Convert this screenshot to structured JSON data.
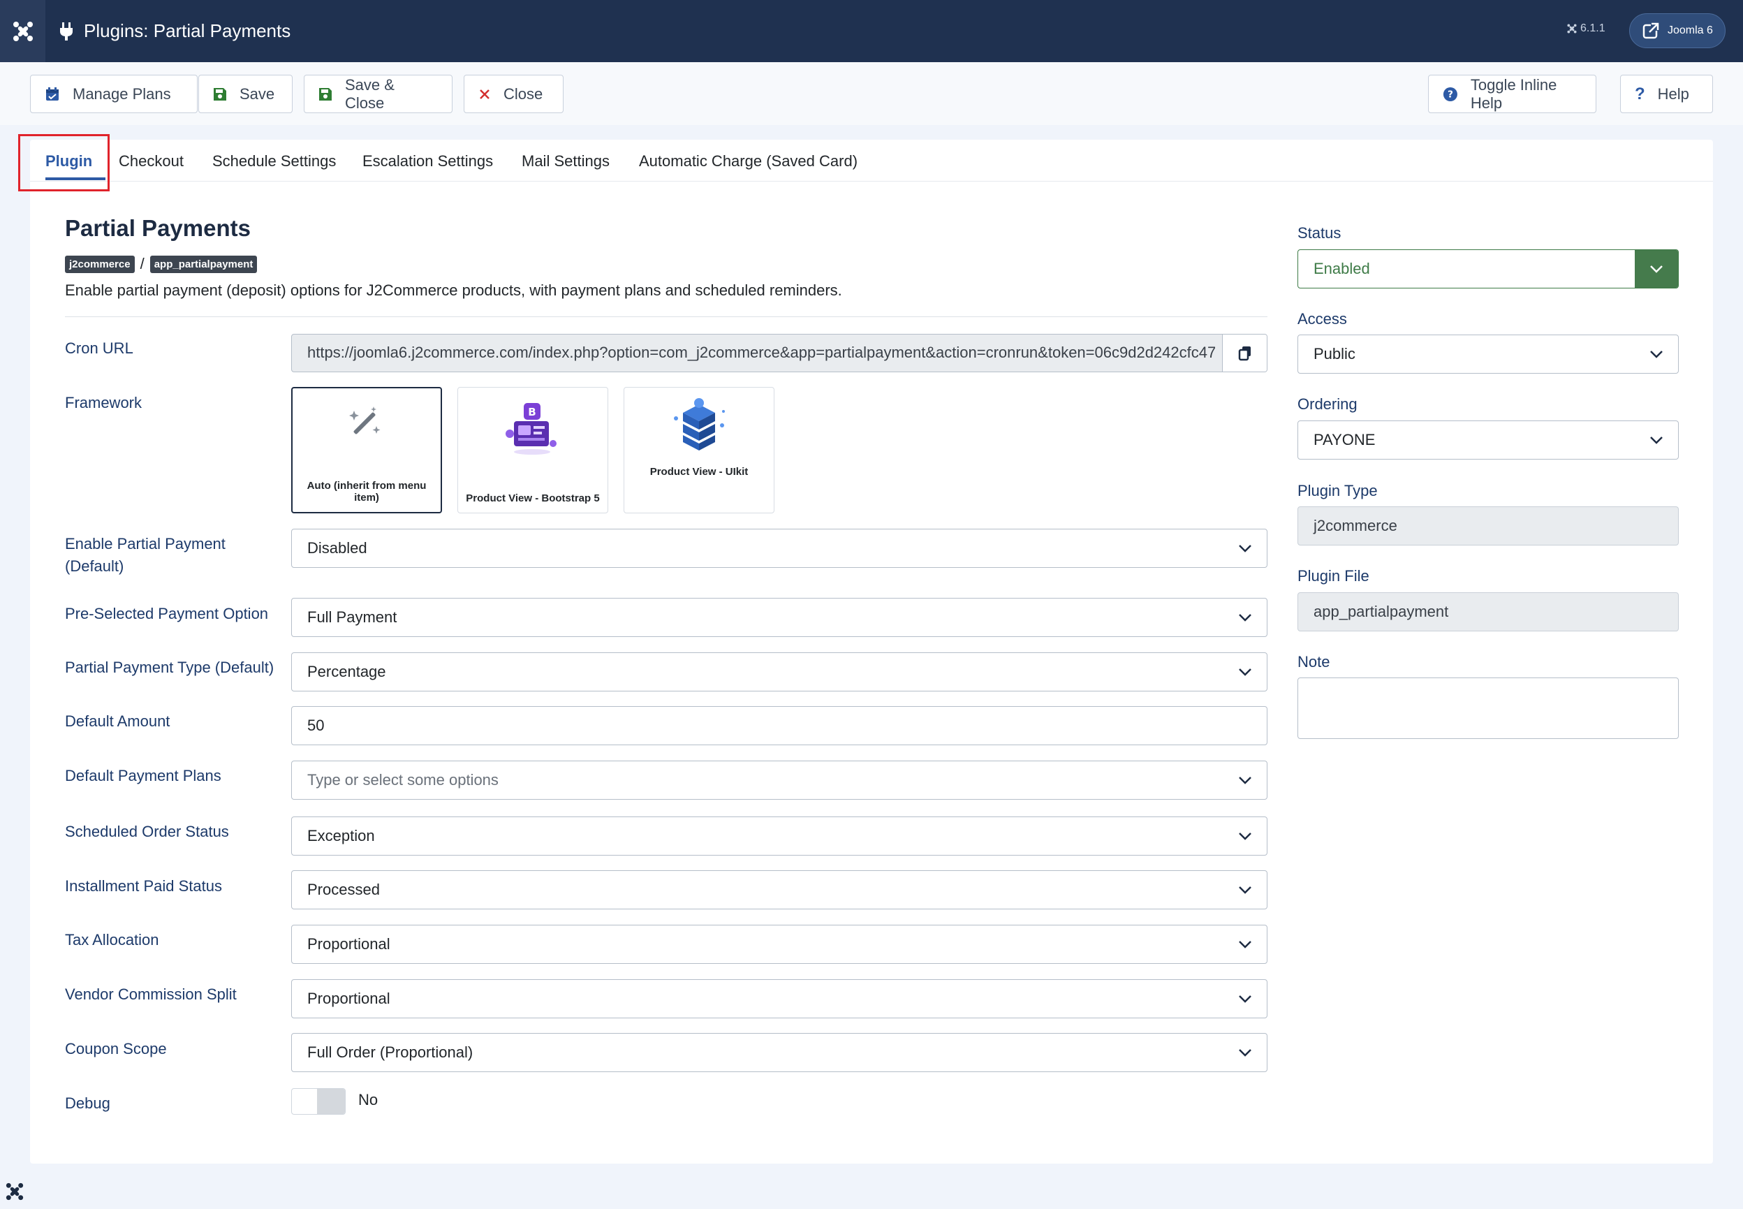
{
  "header": {
    "title": "Plugins: Partial Payments",
    "version": "6.1.1",
    "site_label": "Joomla 6"
  },
  "toolbar": {
    "manage_plans": "Manage Plans",
    "save": "Save",
    "save_close": "Save & Close",
    "close": "Close",
    "toggle_help": "Toggle Inline Help",
    "help": "Help"
  },
  "tabs": [
    "Plugin",
    "Checkout",
    "Schedule Settings",
    "Escalation Settings",
    "Mail Settings",
    "Automatic Charge (Saved Card)"
  ],
  "plugin": {
    "name": "Partial Payments",
    "badge_group": "j2commerce",
    "badge_element": "app_partialpayment",
    "separator": "/",
    "description": "Enable partial payment (deposit) options for J2Commerce products, with payment plans and scheduled reminders."
  },
  "form": {
    "cron_label": "Cron URL",
    "cron_url": "https://joomla6.j2commerce.com/index.php?option=com_j2commerce&app=partialpayment&action=cronrun&token=06c9d2d242cfc47",
    "framework_label": "Framework",
    "framework_options": [
      "Auto (inherit from menu item)",
      "Product View - Bootstrap 5",
      "Product View - UIkit"
    ],
    "enable_label": "Enable Partial Payment (Default)",
    "enable_value": "Disabled",
    "preselected_label": "Pre-Selected Payment Option",
    "preselected_value": "Full Payment",
    "type_label": "Partial Payment Type (Default)",
    "type_value": "Percentage",
    "amount_label": "Default Amount",
    "amount_value": "50",
    "plans_label": "Default Payment Plans",
    "plans_placeholder": "Type or select some options",
    "scheduled_label": "Scheduled Order Status",
    "scheduled_value": "Exception",
    "installment_label": "Installment Paid Status",
    "installment_value": "Processed",
    "tax_label": "Tax Allocation",
    "tax_value": "Proportional",
    "vendor_label": "Vendor Commission Split",
    "vendor_value": "Proportional",
    "coupon_label": "Coupon Scope",
    "coupon_value": "Full Order (Proportional)",
    "debug_label": "Debug",
    "debug_value": "No"
  },
  "sidebar": {
    "status_label": "Status",
    "status_value": "Enabled",
    "access_label": "Access",
    "access_value": "Public",
    "ordering_label": "Ordering",
    "ordering_value": "PAYONE",
    "type_label": "Plugin Type",
    "type_value": "j2commerce",
    "file_label": "Plugin File",
    "file_value": "app_partialpayment",
    "note_label": "Note",
    "note_value": ""
  }
}
